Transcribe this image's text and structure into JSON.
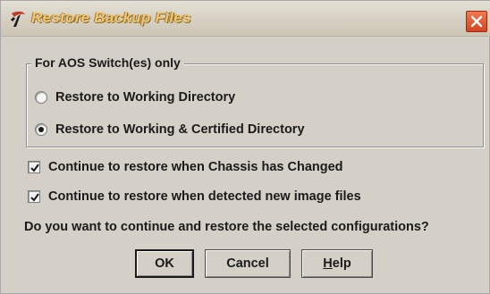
{
  "window": {
    "title": "Restore Backup Files"
  },
  "group": {
    "legend": "For AOS Switch(es) only",
    "options": [
      {
        "label": "Restore to Working Directory",
        "checked": false
      },
      {
        "label": "Restore to Working & Certified Directory",
        "checked": true
      }
    ]
  },
  "checks": [
    {
      "label": "Continue to restore when Chassis has Changed",
      "checked": true
    },
    {
      "label": "Continue to restore when detected new image files",
      "checked": true
    }
  ],
  "question": "Do you want to continue and restore the selected configurations?",
  "buttons": {
    "ok": "OK",
    "cancel": "Cancel",
    "help_mnemonic": "H",
    "help_rest": "elp"
  },
  "colors": {
    "dialog_bg": "#d4d0c8",
    "title_text": "#f2c774",
    "close_button": "#e0562e"
  }
}
